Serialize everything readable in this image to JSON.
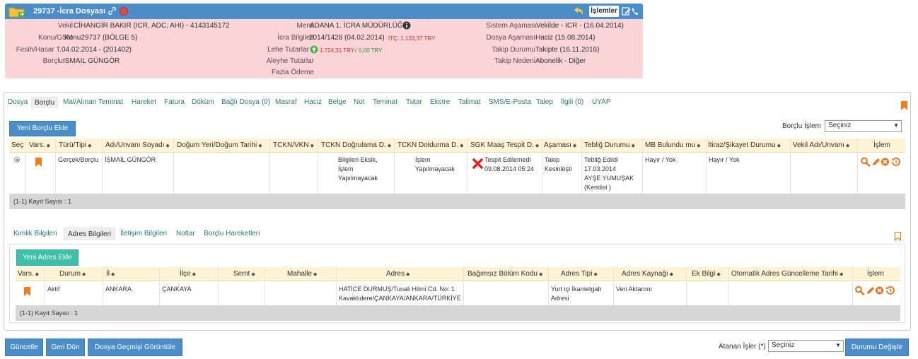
{
  "case": {
    "title": "29737 -İcra Dosyası",
    "islemler": "İşlemler",
    "left": [
      {
        "label": "Vekil",
        "value": "CİHANGİR BAKIR (ICR, ADC, AHI) - 4143145172"
      },
      {
        "label": "Konu/GSM",
        "value": "Konu29737 (BÖLGE 5)"
      },
      {
        "label": "Fesih/Hasar T.",
        "value": "04.02.2014 - (201402)"
      },
      {
        "label": "Borçlu",
        "value": "ISMAIL GÜNGÖR"
      }
    ],
    "middle": {
      "merci_label": "Merci",
      "merci_value": "ADANA 1. İCRA MÜDÜRLÜĞÜ",
      "icra_label": "İcra Bilgileri",
      "icra_value": "2014/1428 (04.02.2014)",
      "itc": "İTÇ: 1.133,37 TRY",
      "lehe_label": "Lehe Tutarlar",
      "lehe_a": "1.724,31 TRY",
      "lehe_sep": "/",
      "lehe_b": "0,00 TRY",
      "aleyhe_label": "Aleyhe Tutarlar",
      "fazla_label": "Fazla Ödeme"
    },
    "right": [
      {
        "label": "Sistem Aşaması",
        "value": "Vekilde - ICR - (16.04.2014)"
      },
      {
        "label": "Dosya Aşaması",
        "value": "Haciz (15.08.2014)"
      },
      {
        "label": "Takip Durumu",
        "value": "Takipte (16.11.2016)"
      },
      {
        "label": "Takip Nedeni",
        "value": "Abonelik - Diğer"
      }
    ]
  },
  "tabs": [
    "Dosya",
    "Borçlu",
    "Mal/Alınan Teminat",
    "Hareket",
    "Fatura",
    "Döküm",
    "Bağlı Dosya (0)",
    "Masraf",
    "Haciz",
    "Belge",
    "Not",
    "Teminat",
    "Tutar",
    "Ekstre",
    "Talimat",
    "SMS/E-Posta",
    "Talep",
    "İlgili (0)",
    "UYAP"
  ],
  "borclu": {
    "add_button": "Yeni Borçlu Ekle",
    "islem_label": "Borçlu İşlem",
    "islem_select": "Seçiniz",
    "columns": [
      "Seç",
      "Vars.",
      "Türü/Tipi",
      "Adı/Unvanı Soyadı",
      "Doğum Yeri/Doğum Tarihi",
      "TCKN/VKN",
      "TCKN Doğrulama D.",
      "TCKN Doldurma D.",
      "SGK Maaş Tespit D.",
      "Aşaması",
      "Tebliğ Durumu",
      "MB Bulundu mu",
      "İtiraz/Şikayet Durumu",
      "Vekil Adı/Unvanı",
      "İşlem"
    ],
    "row": {
      "turu": "Gerçek/Borçlu",
      "adi": "İSMAİL GÜNGÖR",
      "dogrulama": [
        "Bilgileri Eksik,",
        "İşlem",
        "Yapılmayacak"
      ],
      "doldurma": [
        "İşlem",
        "Yapılmayacak"
      ],
      "sgk": [
        "Tespit Edilemedi",
        "09.08.2014 05:24"
      ],
      "asama": [
        "Takip",
        "Kesinleşti"
      ],
      "teblig": [
        "Tebliğ Edildi",
        "17.03.2014",
        "AYŞE YUMUŞAK",
        "(Kendisi )"
      ],
      "mb": "Hayır / Yok",
      "itiraz": "Hayır / Yok"
    },
    "count": "(1-1) Kayıt Sayısı : 1"
  },
  "subtabs": [
    "Kimlik Bilgileri",
    "Adres Bilgileri",
    "İletişim Bilgileri",
    "Notlar",
    "Borçlu Hareketleri"
  ],
  "adres": {
    "add_button": "Yeni Adres Ekle",
    "columns": [
      "Vars.",
      "Durum",
      "İl",
      "İlçe",
      "Semt",
      "Mahalle",
      "Adres",
      "Bağımsız Bölüm Kodu",
      "Adres Tipi",
      "Adres Kaynağı",
      "Ek Bilgi",
      "Otomatik Adres Güncelleme Tarihi",
      "İşlem"
    ],
    "row": {
      "durum": "Aktif",
      "il": "ANKARA",
      "ilce": "ÇANKAYA",
      "adres": [
        "HATİCE DURMUŞ/Tunali Hilmi Cd. No: 1",
        "Kavaklıdere/ÇANKAYA/ANKARA/TÜRKİYE"
      ],
      "tipi": [
        "Yurt içi İkametgah",
        "Adresi"
      ],
      "kaynak": "Veri Aktarımı"
    },
    "count": "(1-1) Kayıt Sayısı : 1"
  },
  "bottom": {
    "guncelle": "Güncelle",
    "geri": "Geri Dön",
    "gecmis": "Dosya Geçmişi Görüntüle",
    "atanan_label": "Atanan İşler (*)",
    "atanan_select": "Seçiniz",
    "durum_btn": "Durumu Değiştir"
  },
  "colors": {
    "bar": "#4b8dc9",
    "card": "#fbd4d8",
    "teal": "#3cc0a9",
    "orange": "#f07c1b"
  }
}
